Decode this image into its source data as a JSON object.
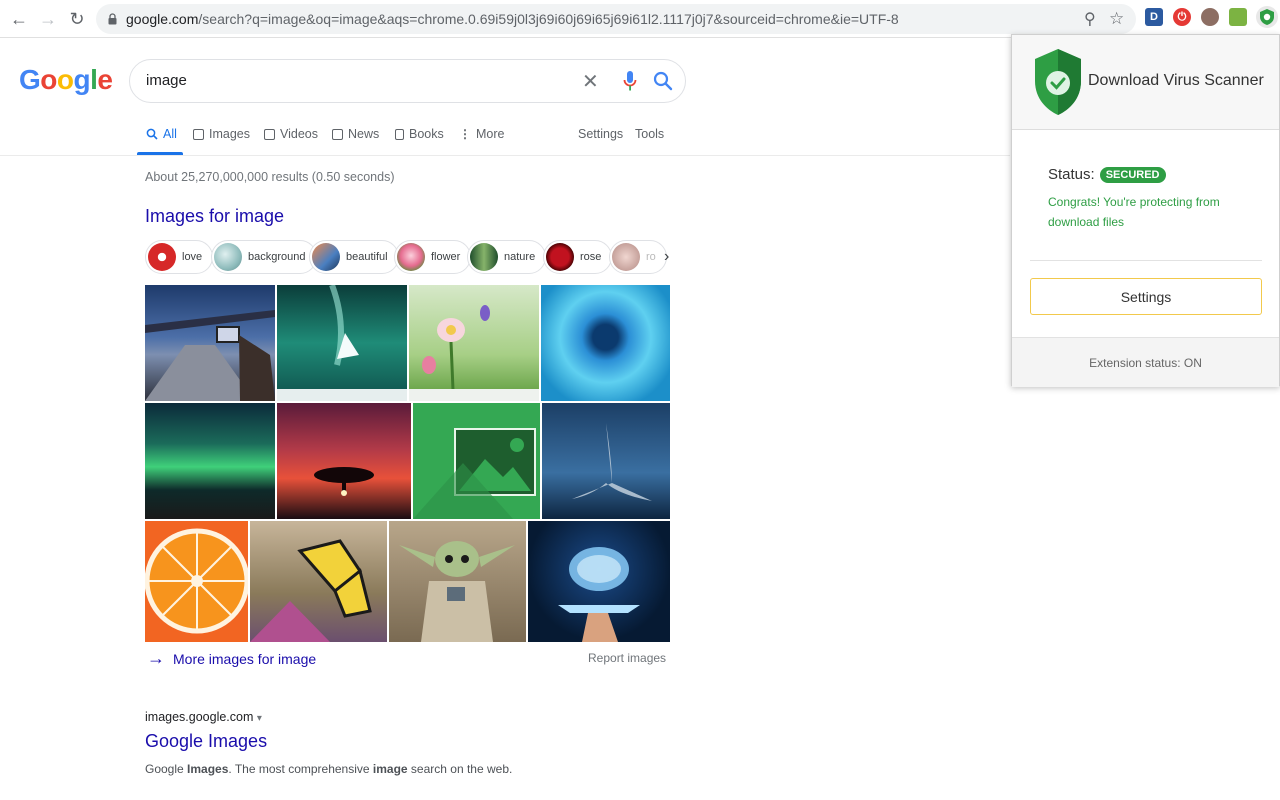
{
  "browser": {
    "url_domain": "google.com",
    "url_rest": "/search?q=image&oq=image&aqs=chrome.0.69i59j0l3j69i60j69i65j69i61l2.1117j0j7&sourceid=chrome&ie=UTF-8",
    "extensions": [
      {
        "icon": "d-extension-icon",
        "letter": "D",
        "color": "#2c5aa0"
      },
      {
        "icon": "power-extension-icon",
        "letter": "⏻",
        "color": "#e53935"
      },
      {
        "icon": "avatar-extension-icon",
        "letter": "",
        "color": "#8d6e63"
      },
      {
        "icon": "map-extension-icon",
        "letter": "",
        "color": "#7cb342"
      },
      {
        "icon": "shield-extension-icon",
        "letter": "✓",
        "color": "#2e9e44"
      }
    ]
  },
  "google": {
    "logo": [
      "G",
      "o",
      "o",
      "g",
      "l",
      "e"
    ],
    "logo_colors": [
      "#4285f4",
      "#ea4335",
      "#fbbc05",
      "#4285f4",
      "#34a853",
      "#ea4335"
    ],
    "query": "image",
    "tabs": {
      "all": "All",
      "images": "Images",
      "videos": "Videos",
      "news": "News",
      "books": "Books",
      "more": "More",
      "settings": "Settings",
      "tools": "Tools"
    },
    "result_stats": "About 25,270,000,000 results (0.50 seconds)",
    "images_heading": "Images for image",
    "chips": [
      "love",
      "background",
      "beautiful",
      "flower",
      "nature",
      "rose",
      "ro"
    ],
    "more_images": "More images for image",
    "report_images": "Report images",
    "result": {
      "cite": "images.google.com",
      "cite_arrow": "▾",
      "title": "Google Images",
      "snippet_a": "Google ",
      "snippet_b": "Images",
      "snippet_c": ". The most comprehensive ",
      "snippet_d": "image",
      "snippet_e": " search on the web."
    }
  },
  "popup": {
    "title": "Download Virus Scanner",
    "status_label": "Status:",
    "status_badge": "SECURED",
    "congrats": "Congrats! You're protecting from download files",
    "settings_button": "Settings",
    "extension_status": "Extension status: ON",
    "accent_color": "#2e9e44"
  }
}
